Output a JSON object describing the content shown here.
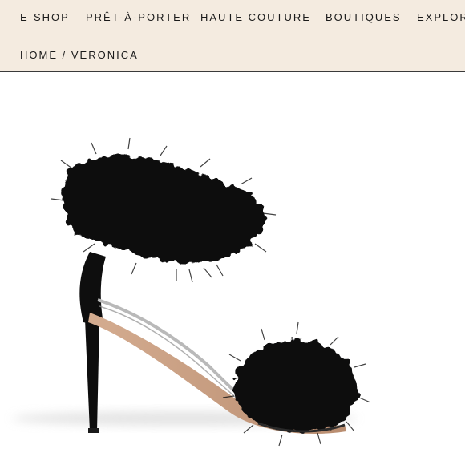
{
  "nav": {
    "items": [
      {
        "label": "E-SHOP"
      },
      {
        "label": "PRÊT-À-PORTER"
      },
      {
        "label": "HAUTE COUTURE"
      },
      {
        "label": "BOUTIQUES"
      },
      {
        "label": "EXPLORE"
      }
    ]
  },
  "breadcrumb": {
    "home": "HOME",
    "separator": "/",
    "current": "VERONICA"
  },
  "product": {
    "image_subject": "black feather strappy high-heel sandal",
    "colors": {
      "feather": "#0b0b0c",
      "sole": "#caa085",
      "background": "#ffffff",
      "nav_bg": "#f4ebe0"
    }
  }
}
